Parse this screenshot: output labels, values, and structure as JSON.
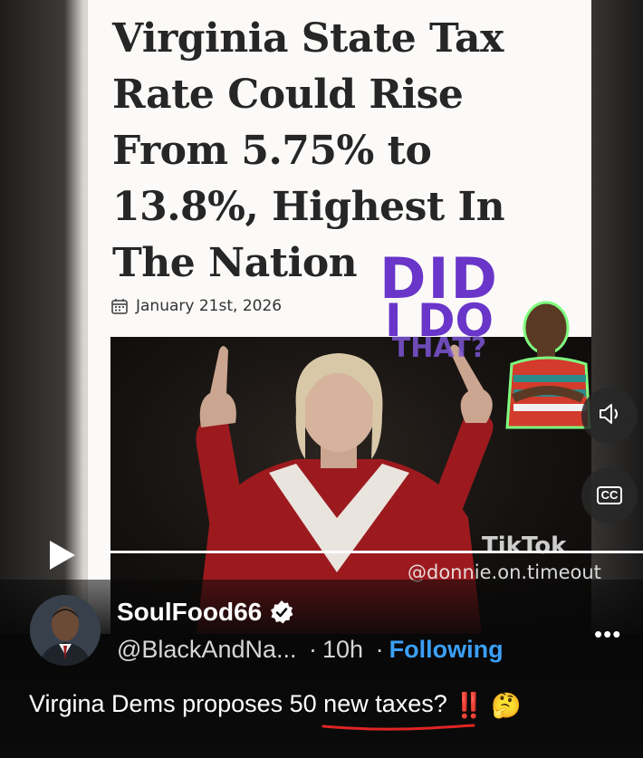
{
  "article": {
    "headline": "Virginia State Tax Rate Could Rise From 5.75% to 13.8%, Highest In The Nation",
    "date": "January 21st, 2026"
  },
  "sticker": {
    "line1": "DID",
    "line2": "I DO",
    "line3": "THAT?"
  },
  "watermark": {
    "logo": "TikTok",
    "handle": "@donnie.on.timeout"
  },
  "video": {
    "progress_percent": 100
  },
  "controls": {
    "sound_icon": "speaker-icon",
    "cc_label": "CC",
    "play_icon": "play-icon",
    "more_icon": "more-icon"
  },
  "post": {
    "username": "SoulFood66",
    "handle": "@BlackAndNa...",
    "separator": "·",
    "time": "10h",
    "following": "Following",
    "caption_before": "Virgina Dems proposes ",
    "caption_highlight": "50 new taxes?",
    "caption_emoji": "‼️ 🤔"
  },
  "colors": {
    "accent": "#3b9ff6",
    "sticker": "#6a35c9",
    "underline": "#e02424"
  }
}
